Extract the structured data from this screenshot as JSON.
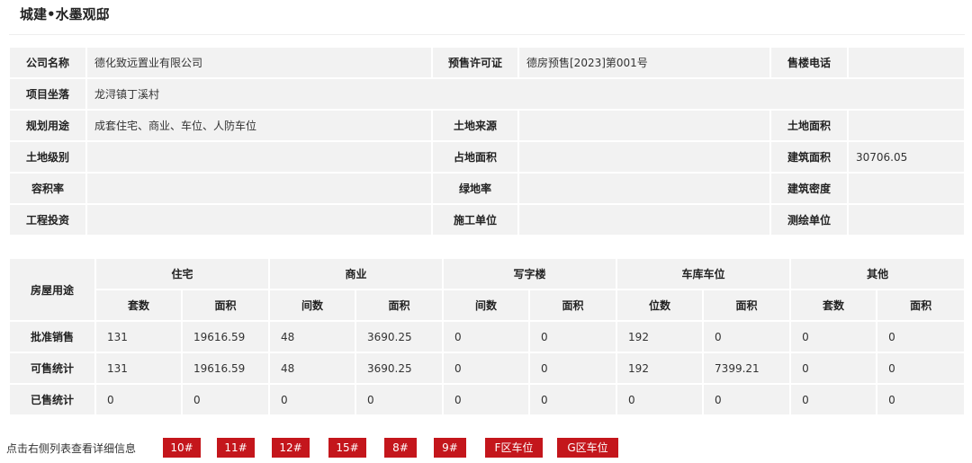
{
  "page": {
    "title": "城建•水墨观邸"
  },
  "info": {
    "company_label": "公司名称",
    "company_value": "德化致远置业有限公司",
    "permit_label": "预售许可证",
    "permit_value": "德房预售[2023]第001号",
    "phone_label": "售楼电话",
    "phone_value": "",
    "location_label": "项目坐落",
    "location_value": "龙浔镇丁溪村",
    "usage_label": "规划用途",
    "usage_value": "成套住宅、商业、车位、人防车位",
    "land_source_label": "土地来源",
    "land_source_value": "",
    "land_area_label": "土地面积",
    "land_area_value": "",
    "land_grade_label": "土地级别",
    "land_grade_value": "",
    "occupied_area_label": "占地面积",
    "occupied_area_value": "",
    "building_area_label": "建筑面积",
    "building_area_value": "30706.05",
    "plot_ratio_label": "容积率",
    "plot_ratio_value": "",
    "green_ratio_label": "绿地率",
    "green_ratio_value": "",
    "building_density_label": "建筑密度",
    "building_density_value": "",
    "investment_label": "工程投资",
    "investment_value": "",
    "construction_label": "施工单位",
    "construction_value": "",
    "survey_label": "测绘单位",
    "survey_value": ""
  },
  "stats": {
    "usage_header": "房屋用途",
    "groups": [
      "住宅",
      "商业",
      "写字楼",
      "车库车位",
      "其他"
    ],
    "subheaders": [
      "套数",
      "面积",
      "间数",
      "面积",
      "间数",
      "面积",
      "位数",
      "面积",
      "套数",
      "面积"
    ],
    "rows": [
      {
        "label": "批准销售",
        "values": [
          "131",
          "19616.59",
          "48",
          "3690.25",
          "0",
          "0",
          "192",
          "0",
          "0",
          "0"
        ]
      },
      {
        "label": "可售统计",
        "values": [
          "131",
          "19616.59",
          "48",
          "3690.25",
          "0",
          "0",
          "192",
          "7399.21",
          "0",
          "0"
        ]
      },
      {
        "label": "已售统计",
        "values": [
          "0",
          "0",
          "0",
          "0",
          "0",
          "0",
          "0",
          "0",
          "0",
          "0"
        ]
      }
    ]
  },
  "footer": {
    "hint": "点击右侧列表查看详细信息",
    "buttons": [
      "10#",
      "11#",
      "12#",
      "15#",
      "8#",
      "9#",
      "F区车位",
      "G区车位"
    ]
  }
}
